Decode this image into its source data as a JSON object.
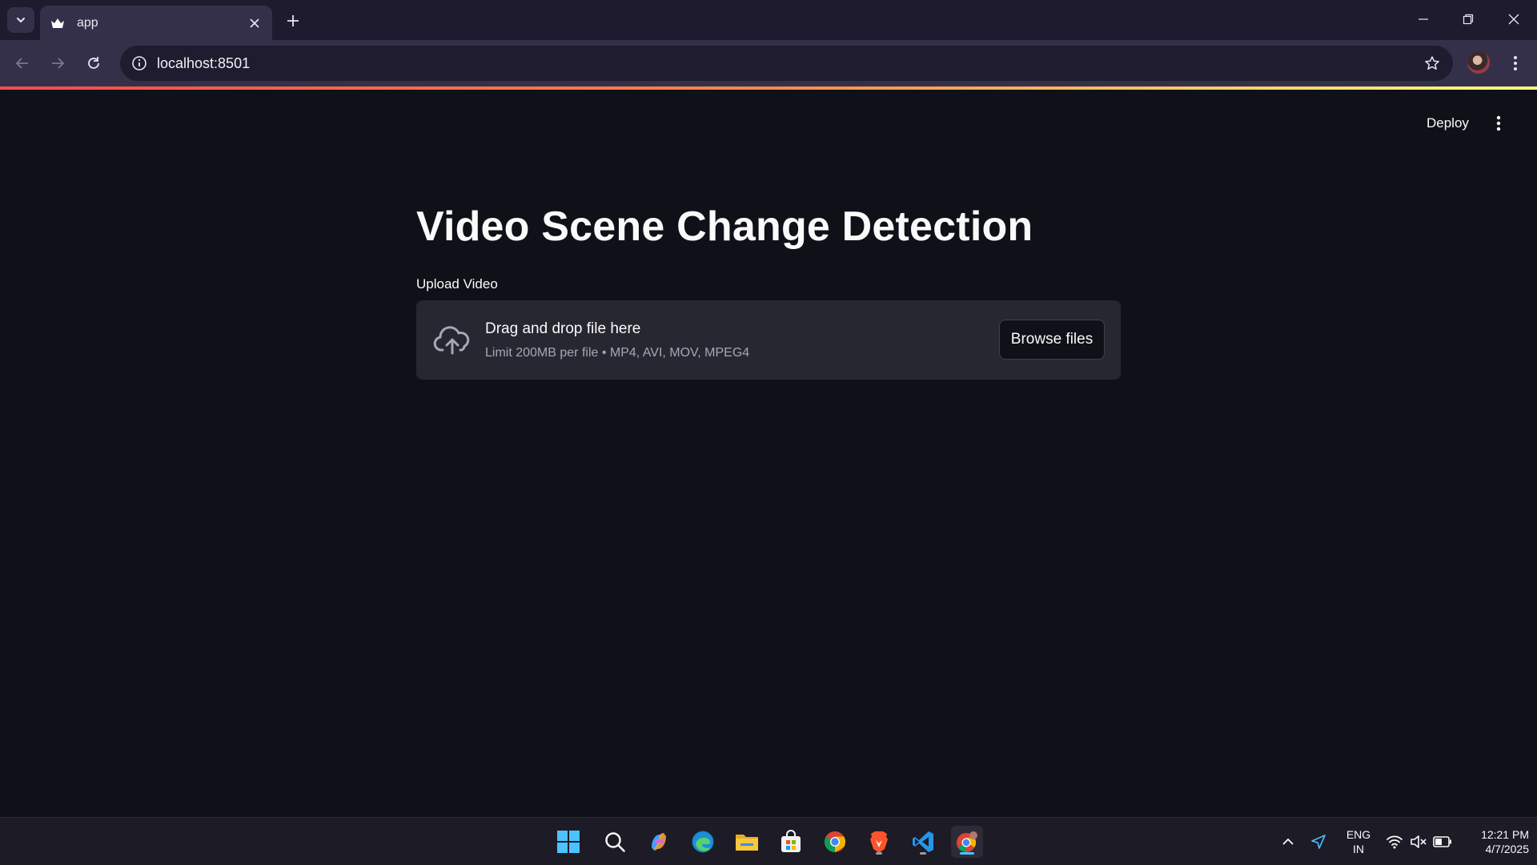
{
  "browser": {
    "tab": {
      "title": "app"
    },
    "address": {
      "url": "localhost:8501"
    }
  },
  "streamlit_header": {
    "deploy_label": "Deploy"
  },
  "main": {
    "title": "Video Scene Change Detection",
    "uploader": {
      "label": "Upload Video",
      "dropzone_title": "Drag and drop file here",
      "dropzone_subtitle": "Limit 200MB per file • MP4, AVI, MOV, MPEG4",
      "browse_label": "Browse files"
    }
  },
  "taskbar": {
    "apps": [
      "start",
      "search",
      "copilot",
      "edge",
      "file-explorer",
      "microsoft-store",
      "chrome",
      "brave",
      "vscode",
      "chrome-profile"
    ],
    "language": {
      "line1": "ENG",
      "line2": "IN"
    },
    "clock": {
      "time": "12:21 PM",
      "date": "4/7/2025"
    }
  },
  "colors": {
    "app_bg": "#0e1117",
    "dropzone_bg": "#262730",
    "browser_frame": "#35304a",
    "accent_line_start": "#ff4b4b",
    "accent_line_end": "#fffd80"
  }
}
